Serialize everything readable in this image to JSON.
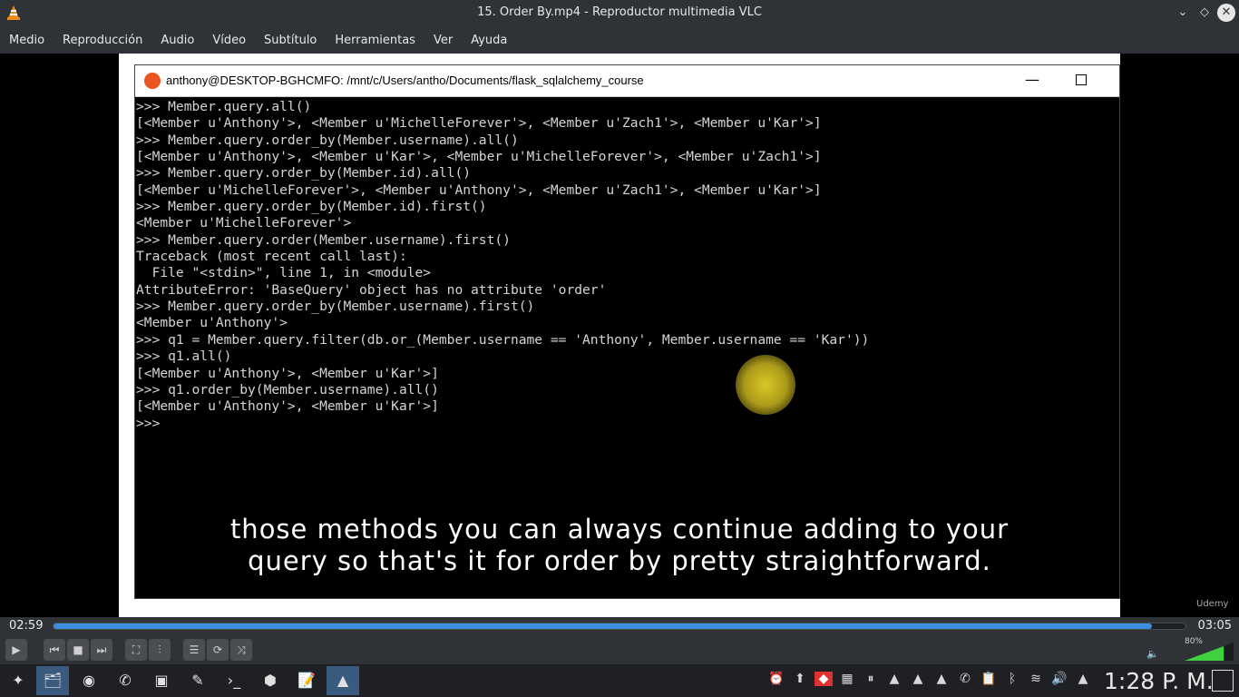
{
  "window": {
    "title": "15. Order By.mp4 - Reproductor multimedia VLC",
    "controls": {
      "minimize": "⌄",
      "restore": "◇",
      "close": "✕"
    }
  },
  "menu": [
    "Medio",
    "Reproducción",
    "Audio",
    "Vídeo",
    "Subtítulo",
    "Herramientas",
    "Ver",
    "Ayuda"
  ],
  "video": {
    "terminal_title": "anthony@DESKTOP-BGHCMFO: /mnt/c/Users/antho/Documents/flask_sqlalchemy_course",
    "terminal_lines": [
      ">>> Member.query.all()",
      "[<Member u'Anthony'>, <Member u'MichelleForever'>, <Member u'Zach1'>, <Member u'Kar'>]",
      ">>> Member.query.order_by(Member.username).all()",
      "[<Member u'Anthony'>, <Member u'Kar'>, <Member u'MichelleForever'>, <Member u'Zach1'>]",
      ">>> Member.query.order_by(Member.id).all()",
      "[<Member u'MichelleForever'>, <Member u'Anthony'>, <Member u'Zach1'>, <Member u'Kar'>]",
      ">>> Member.query.order_by(Member.id).first()",
      "<Member u'MichelleForever'>",
      ">>> Member.query.order(Member.username).first()",
      "Traceback (most recent call last):",
      "  File \"<stdin>\", line 1, in <module>",
      "AttributeError: 'BaseQuery' object has no attribute 'order'",
      ">>> Member.query.order_by(Member.username).first()",
      "<Member u'Anthony'>",
      ">>> q1 = Member.query.filter(db.or_(Member.username == 'Anthony', Member.username == 'Kar'))",
      ">>> q1.all()",
      "[<Member u'Anthony'>, <Member u'Kar'>]",
      ">>> q1.order_by(Member.username).all()",
      "[<Member u'Anthony'>, <Member u'Kar'>]",
      ">>> "
    ],
    "subtitle_lines": [
      "those methods you can always continue adding to your",
      "query so that's it for order by pretty straightforward."
    ],
    "watermark": "Udemy"
  },
  "playback": {
    "elapsed": "02:59",
    "total": "03:05",
    "progress": 0.97
  },
  "volume": {
    "label": "80%",
    "level": 0.8
  },
  "clock": "1:28 P. M."
}
